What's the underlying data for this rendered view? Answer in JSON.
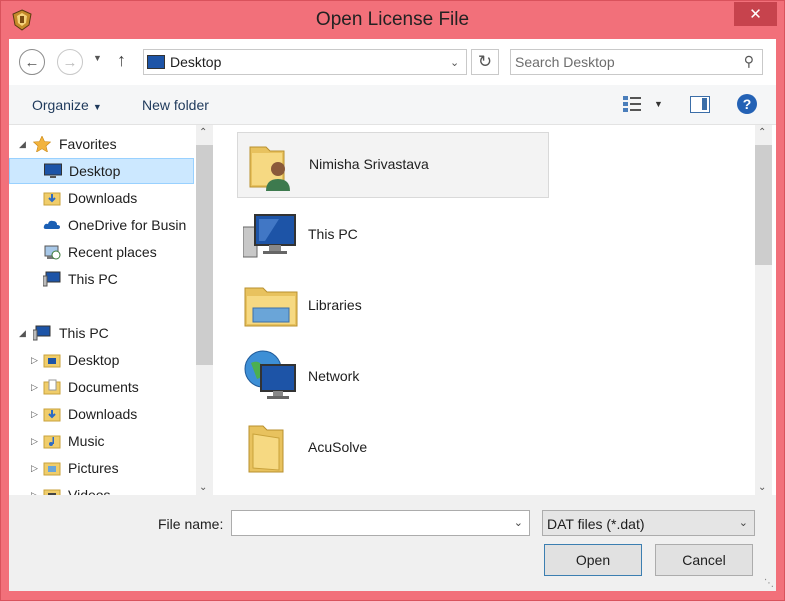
{
  "window": {
    "title": "Open License File",
    "close_glyph": "✕"
  },
  "address": {
    "crumb": "Desktop",
    "search_placeholder": "Search Desktop"
  },
  "toolbar": {
    "organize": "Organize",
    "new_folder": "New folder"
  },
  "nav_pane": {
    "items": [
      {
        "label": "Favorites",
        "icon": "star-icon"
      },
      {
        "label": "Desktop",
        "icon": "desktop-icon",
        "selected": true
      },
      {
        "label": "Downloads",
        "icon": "downloads-folder-icon"
      },
      {
        "label": "OneDrive for Busin",
        "icon": "onedrive-cloud-icon"
      },
      {
        "label": "Recent places",
        "icon": "recent-places-icon"
      },
      {
        "label": "This PC",
        "icon": "computer-icon"
      },
      {
        "label": "This PC",
        "icon": "computer-icon"
      },
      {
        "label": "Desktop",
        "icon": "desktop-folder-icon"
      },
      {
        "label": "Documents",
        "icon": "documents-folder-icon"
      },
      {
        "label": "Downloads",
        "icon": "downloads-folder-icon"
      },
      {
        "label": "Music",
        "icon": "music-folder-icon"
      },
      {
        "label": "Pictures",
        "icon": "pictures-folder-icon"
      },
      {
        "label": "Videos",
        "icon": "videos-folder-icon"
      }
    ]
  },
  "content": {
    "items": [
      {
        "name": "Nimisha Srivastava",
        "icon": "user-folder-icon"
      },
      {
        "name": "This PC",
        "icon": "computer-icon"
      },
      {
        "name": "Libraries",
        "icon": "libraries-folder-icon"
      },
      {
        "name": "Network",
        "icon": "network-icon"
      },
      {
        "name": "AcuSolve",
        "icon": "folder-icon"
      }
    ]
  },
  "bottom": {
    "file_name_label": "File name:",
    "file_name_value": "",
    "file_type": "DAT files (*.dat)",
    "open": "Open",
    "cancel": "Cancel"
  },
  "colors": {
    "frame": "#f2707a",
    "close_button": "#c7434d",
    "selection": "#cce8ff",
    "link_text": "#1e395b"
  }
}
